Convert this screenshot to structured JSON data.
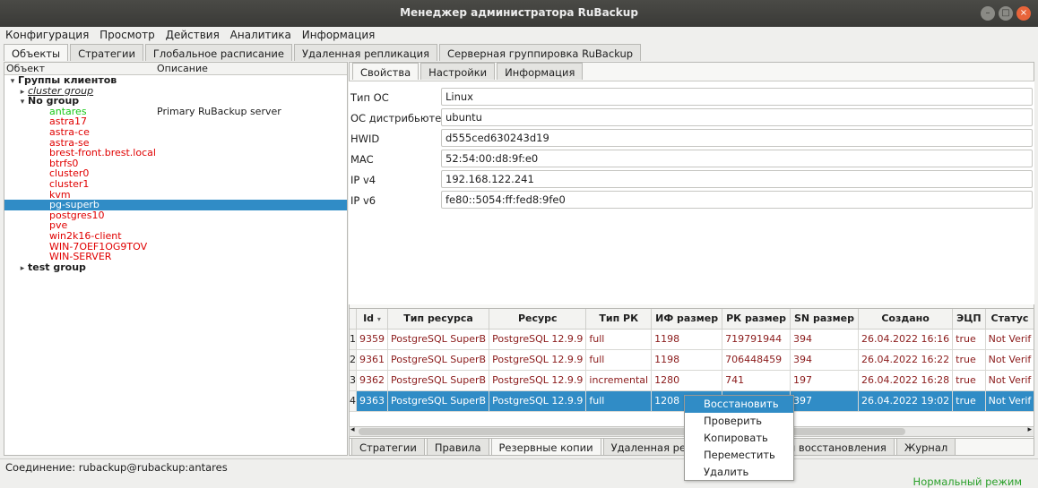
{
  "window": {
    "title": "Менеджер администратора RuBackup"
  },
  "menubar": [
    "Конфигурация",
    "Просмотр",
    "Действия",
    "Аналитика",
    "Информация"
  ],
  "main_tabs": [
    "Объекты",
    "Стратегии",
    "Глобальное расписание",
    "Удаленная репликация",
    "Серверная группировка RuBackup"
  ],
  "tree": {
    "headers": {
      "object": "Объект",
      "description": "Описание"
    },
    "items": [
      {
        "label": "Группы клиентов",
        "level": 0,
        "style": "bold",
        "arrow": "▾",
        "desc": ""
      },
      {
        "label": "cluster group",
        "level": 1,
        "style": "italic",
        "arrow": "▸",
        "desc": ""
      },
      {
        "label": "No group",
        "level": 1,
        "style": "bold",
        "arrow": "▾",
        "desc": ""
      },
      {
        "label": "antares",
        "level": 2,
        "style": "green",
        "arrow": "",
        "desc": "Primary RuBackup server"
      },
      {
        "label": "astra17",
        "level": 2,
        "style": "red",
        "arrow": "",
        "desc": ""
      },
      {
        "label": "astra-ce",
        "level": 2,
        "style": "red",
        "arrow": "",
        "desc": ""
      },
      {
        "label": "astra-se",
        "level": 2,
        "style": "red",
        "arrow": "",
        "desc": ""
      },
      {
        "label": "brest-front.brest.local",
        "level": 2,
        "style": "red",
        "arrow": "",
        "desc": ""
      },
      {
        "label": "btrfs0",
        "level": 2,
        "style": "red",
        "arrow": "",
        "desc": ""
      },
      {
        "label": "cluster0",
        "level": 2,
        "style": "red",
        "arrow": "",
        "desc": ""
      },
      {
        "label": "cluster1",
        "level": 2,
        "style": "red",
        "arrow": "",
        "desc": ""
      },
      {
        "label": "kvm",
        "level": 2,
        "style": "red",
        "arrow": "",
        "desc": ""
      },
      {
        "label": "pg-superb",
        "level": 2,
        "style": "selected",
        "arrow": "",
        "desc": ""
      },
      {
        "label": "postgres10",
        "level": 2,
        "style": "red",
        "arrow": "",
        "desc": ""
      },
      {
        "label": "pve",
        "level": 2,
        "style": "red",
        "arrow": "",
        "desc": ""
      },
      {
        "label": "win2k16-client",
        "level": 2,
        "style": "red",
        "arrow": "",
        "desc": ""
      },
      {
        "label": "WIN-7OEF1OG9TOV",
        "level": 2,
        "style": "red",
        "arrow": "",
        "desc": ""
      },
      {
        "label": "WIN-SERVER",
        "level": 2,
        "style": "red",
        "arrow": "",
        "desc": ""
      },
      {
        "label": "test group",
        "level": 1,
        "style": "bold",
        "arrow": "▸",
        "desc": ""
      }
    ]
  },
  "sub_tabs": [
    "Свойства",
    "Настройки",
    "Информация"
  ],
  "properties": [
    {
      "label": "Тип ОС",
      "value": "Linux"
    },
    {
      "label": "ОС дистрибьютер",
      "value": "ubuntu"
    },
    {
      "label": "HWID",
      "value": "d555ced630243d19"
    },
    {
      "label": "MAC",
      "value": "52:54:00:d8:9f:e0"
    },
    {
      "label": "IP v4",
      "value": "192.168.122.241"
    },
    {
      "label": "IP v6",
      "value": "fe80::5054:ff:fed8:9fe0"
    }
  ],
  "table": {
    "columns": [
      "Id",
      "Тип ресурса",
      "Ресурс",
      "Тип РК",
      "ИФ размер",
      "РК размер",
      "SN размер",
      "Создано",
      "ЭЦП",
      "Статус"
    ],
    "rows": [
      {
        "num": "1",
        "cells": [
          "9359",
          "PostgreSQL SuperB",
          "PostgreSQL 12.9.9",
          "full",
          "1198",
          "719791944",
          "394",
          "26.04.2022 16:16",
          "true",
          "Not Verif"
        ]
      },
      {
        "num": "2",
        "cells": [
          "9361",
          "PostgreSQL SuperB",
          "PostgreSQL 12.9.9",
          "full",
          "1198",
          "706448459",
          "394",
          "26.04.2022 16:22",
          "true",
          "Not Verif"
        ]
      },
      {
        "num": "3",
        "cells": [
          "9362",
          "PostgreSQL SuperB",
          "PostgreSQL 12.9.9",
          "incremental",
          "1280",
          "741",
          "197",
          "26.04.2022 16:28",
          "true",
          "Not Verif"
        ]
      },
      {
        "num": "4",
        "cells": [
          "9363",
          "PostgreSQL SuperB",
          "PostgreSQL 12.9.9",
          "full",
          "1208",
          "",
          "397",
          "26.04.2022 19:02",
          "true",
          "Not Verif"
        ]
      }
    ],
    "selected_row": 3
  },
  "bottom_tabs": [
    "Стратегии",
    "Правила",
    "Резервные копии",
    "Удаленная репликация",
    "Задачи восстановления",
    "Журнал"
  ],
  "context_menu": [
    "Восстановить",
    "Проверить",
    "Копировать",
    "Переместить",
    "Удалить"
  ],
  "status": {
    "connection": "Соединение: rubackup@rubackup:antares",
    "mode": "Нормальный режим"
  },
  "colors": {
    "selection": "#308cc6",
    "offline_client": "#e00000",
    "online_client": "#18c818",
    "mode_text": "#2aa02a"
  }
}
